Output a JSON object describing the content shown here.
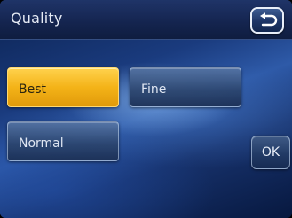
{
  "header": {
    "title": "Quality",
    "back_icon": "back-arrow-icon"
  },
  "options": [
    {
      "label": "Best",
      "selected": true
    },
    {
      "label": "Fine",
      "selected": false
    },
    {
      "label": "Normal",
      "selected": false
    }
  ],
  "actions": {
    "ok_label": "OK"
  },
  "colors": {
    "selected": "#f4b318",
    "header_bg": "#14244e",
    "background": "#1a3b7e"
  }
}
